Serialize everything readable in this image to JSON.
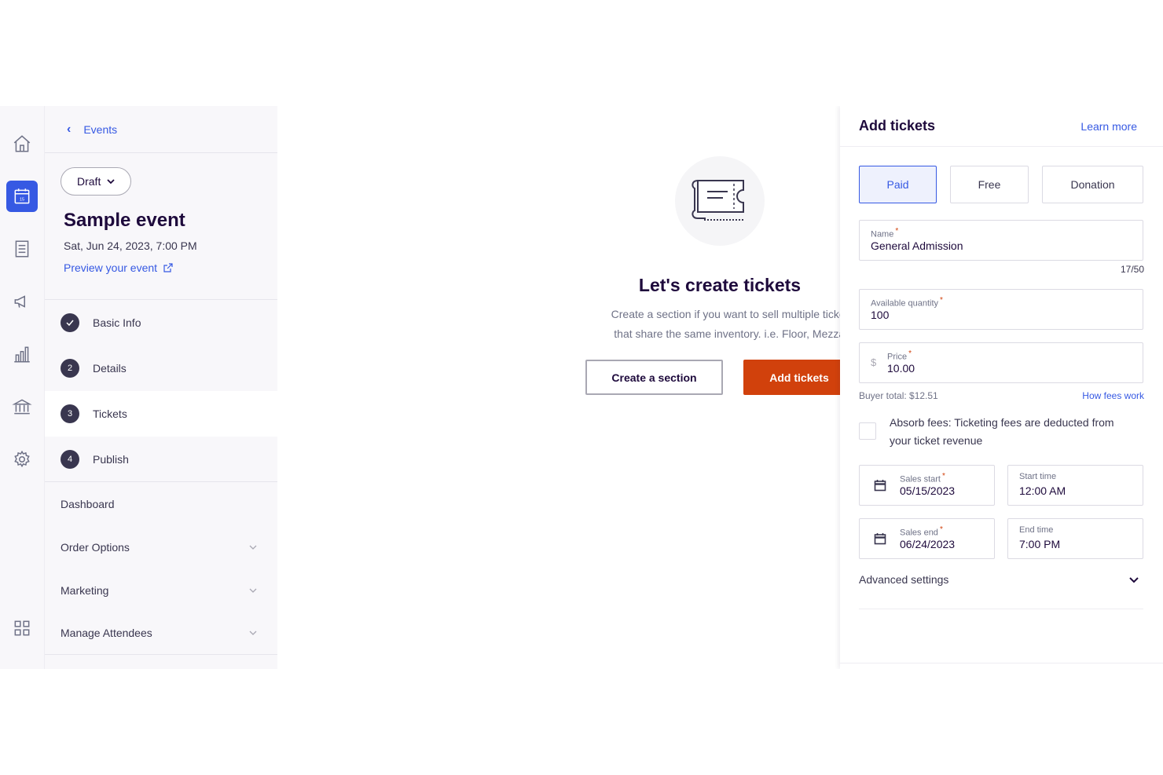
{
  "rail": {
    "icons": [
      "home-icon",
      "calendar-icon",
      "orders-icon",
      "megaphone-icon",
      "chart-icon",
      "bank-icon",
      "gear-icon",
      "apps-grid-icon"
    ],
    "calendar_day": "15"
  },
  "sidebar": {
    "back_label": "Events",
    "status": "Draft",
    "event_title": "Sample event",
    "event_date": "Sat, Jun 24, 2023, 7:00 PM",
    "preview_label": "Preview your event",
    "steps": [
      {
        "num": "",
        "label": "Basic Info",
        "state": "done"
      },
      {
        "num": "2",
        "label": "Details",
        "state": "todo"
      },
      {
        "num": "3",
        "label": "Tickets",
        "state": "active"
      },
      {
        "num": "4",
        "label": "Publish",
        "state": "todo"
      }
    ],
    "nav": [
      {
        "label": "Dashboard"
      },
      {
        "label": "Order Options"
      },
      {
        "label": "Marketing"
      },
      {
        "label": "Manage Attendees"
      }
    ]
  },
  "main": {
    "title": "Let's create tickets",
    "desc_line1": "Create a section if you want to sell multiple ticket ty",
    "desc_line2": "that share the same inventory. i.e. Floor, Mezzanir",
    "create_section_label": "Create a section",
    "add_tickets_label": "Add tickets"
  },
  "panel": {
    "title": "Add tickets",
    "learn_more": "Learn more",
    "types": [
      {
        "label": "Paid",
        "selected": true
      },
      {
        "label": "Free",
        "selected": false
      },
      {
        "label": "Donation",
        "selected": false
      }
    ],
    "name_label": "Name",
    "name_value": "General Admission",
    "name_counter": "17/50",
    "qty_label": "Available quantity",
    "qty_value": "100",
    "price_label": "Price",
    "price_currency": "$",
    "price_value": "10.00",
    "buyer_total": "Buyer total: $12.51",
    "how_fees": "How fees work",
    "absorb_text": "Absorb fees: Ticketing fees are deducted from your ticket revenue",
    "sales_start_label": "Sales start",
    "sales_start_value": "05/15/2023",
    "start_time_label": "Start time",
    "start_time_value": "12:00 AM",
    "sales_end_label": "Sales end",
    "sales_end_value": "06/24/2023",
    "end_time_label": "End time",
    "end_time_value": "7:00 PM",
    "advanced_label": "Advanced settings"
  },
  "colors": {
    "accent": "#3659e3",
    "primary_button": "#d1410c",
    "text_dark": "#1e0a3c"
  }
}
